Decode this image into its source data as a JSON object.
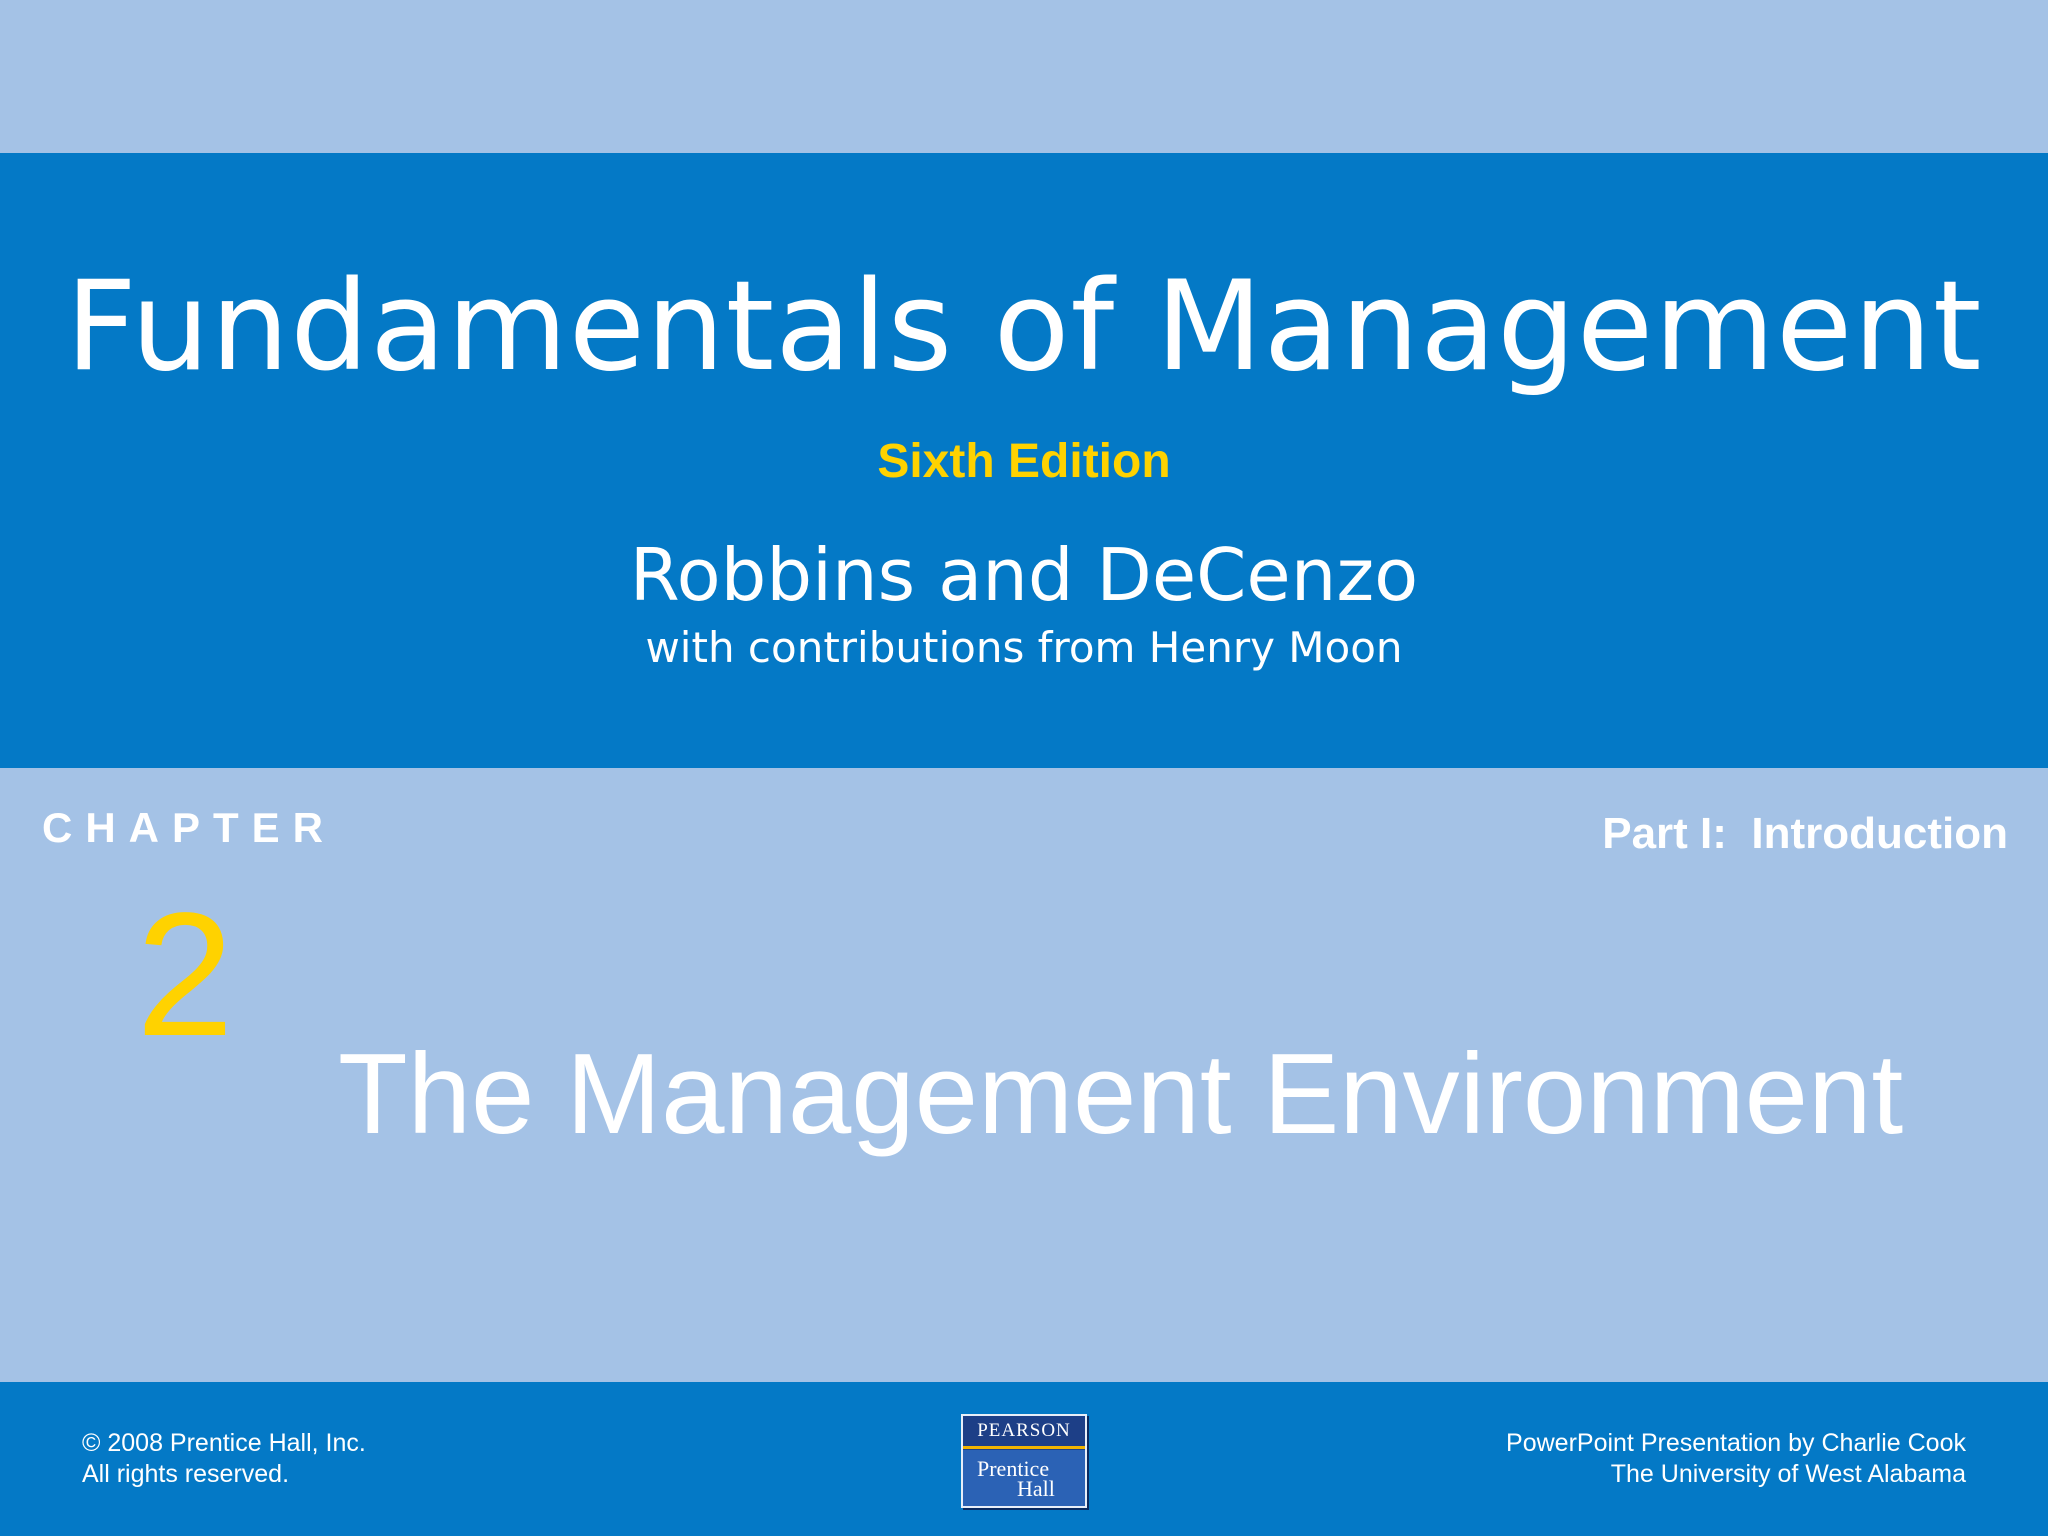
{
  "slide": {
    "book_title": "Fundamentals of Management",
    "edition": "Sixth Edition",
    "authors": "Robbins and DeCenzo",
    "contributions": "with contributions from Henry Moon",
    "chapter_label": "CHAPTER",
    "part_label": "Part I:  Introduction",
    "chapter_number": "2",
    "chapter_title": "The Management Environment"
  },
  "footer": {
    "copyright_line1": "© 2008 Prentice Hall, Inc.",
    "copyright_line2": "All rights reserved.",
    "credit_line1": "PowerPoint Presentation by Charlie Cook",
    "credit_line2": "The University of West Alabama",
    "logo": {
      "top": "PEARSON",
      "bottom_line1": "Prentice",
      "bottom_line2": "Hall"
    }
  },
  "colors": {
    "dark_blue": "#0479c6",
    "light_blue": "#a4c2e6",
    "accent_yellow": "#ffd200",
    "text_white": "#ffffff"
  }
}
